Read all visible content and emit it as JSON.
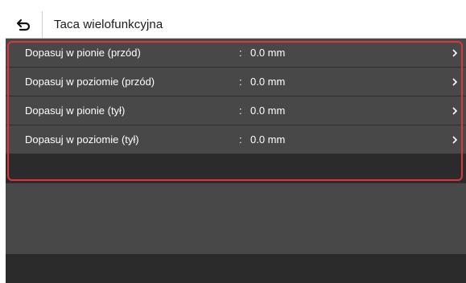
{
  "header": {
    "title": "Taca wielofunkcyjna",
    "back_icon": "back-arrow-icon"
  },
  "settings": {
    "items": [
      {
        "label": "Dopasuj w pionie (przód)",
        "colon": ":",
        "value": "0.0 mm"
      },
      {
        "label": "Dopasuj w poziomie (przód)",
        "colon": ":",
        "value": "0.0 mm"
      },
      {
        "label": "Dopasuj w pionie (tył)",
        "colon": ":",
        "value": "0.0 mm"
      },
      {
        "label": "Dopasuj w poziomie (tył)",
        "colon": ":",
        "value": "0.0 mm"
      }
    ]
  },
  "colors": {
    "highlight": "#e0343a",
    "row_background": "#484848",
    "screen_background": "#2b2b2b",
    "header_background": "#ffffff"
  }
}
